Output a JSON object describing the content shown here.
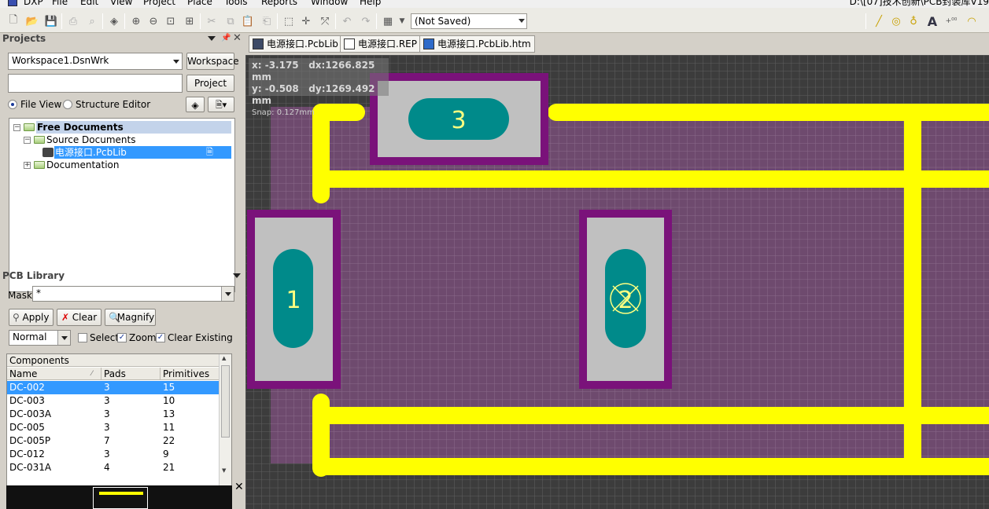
{
  "menubar": {
    "items": [
      "DXP",
      "File",
      "Edit",
      "View",
      "Project",
      "Place",
      "Tools",
      "Reports",
      "Window",
      "Help"
    ],
    "title_path": "D:\\[07]技术创新\\PCB封装库V19"
  },
  "toolbar": {
    "save_state": "(Not Saved)"
  },
  "projects_panel": {
    "title": "Projects",
    "workspace_combo": "Workspace1.DsnWrk",
    "workspace_button": "Workspace",
    "project_input": "",
    "project_button": "Project",
    "view_options": [
      "File View",
      "Structure Editor"
    ],
    "selected_view": "File View",
    "tree": {
      "root": "Free Documents",
      "source_documents": "Source Documents",
      "file": "电源接口.PcbLib",
      "documentation": "Documentation"
    }
  },
  "pcb_library_panel": {
    "title": "PCB Library",
    "mask_label": "Mask",
    "mask_value": "*",
    "apply_button": "Apply",
    "clear_button": "Clear",
    "magnify_button": "Magnify",
    "mode_combo": "Normal",
    "select_label": "Select",
    "select_checked": false,
    "zoom_label": "Zoom",
    "zoom_checked": true,
    "clear_existing_label": "Clear Existing",
    "clear_existing_checked": true,
    "components": {
      "title": "Components",
      "columns": [
        "Name",
        "Pads",
        "Primitives"
      ],
      "rows": [
        {
          "name": "DC-002",
          "pads": "3",
          "primitives": "15",
          "selected": true
        },
        {
          "name": "DC-003",
          "pads": "3",
          "primitives": "10"
        },
        {
          "name": "DC-003A",
          "pads": "3",
          "primitives": "13"
        },
        {
          "name": "DC-005",
          "pads": "3",
          "primitives": "11"
        },
        {
          "name": "DC-005P",
          "pads": "7",
          "primitives": "22"
        },
        {
          "name": "DC-012",
          "pads": "3",
          "primitives": "9"
        },
        {
          "name": "DC-031A",
          "pads": "4",
          "primitives": "21"
        }
      ]
    }
  },
  "document_tabs": [
    "电源接口.PcbLib",
    "电源接口.REP",
    "电源接口.PcbLib.htm"
  ],
  "canvas": {
    "coords": {
      "x": "x: -3.175",
      "dx": "dx:1266.825 mm",
      "y": "y: -0.508",
      "dy": "dy:1269.492 mm",
      "snap": "Snap: 0.127mm"
    },
    "pads": [
      {
        "designator": "3"
      },
      {
        "designator": "1"
      },
      {
        "designator": "2"
      }
    ],
    "colors": {
      "background": "#3c3c3c",
      "grid": "#5f5f5f",
      "keepout_fill": "#6e4a6e",
      "pad_outline": "#7a127a",
      "pad_body": "#c0c0c0",
      "pad_copper": "#008a8a",
      "silkscreen": "#ffff00",
      "pad_label": "#ffff80"
    }
  }
}
